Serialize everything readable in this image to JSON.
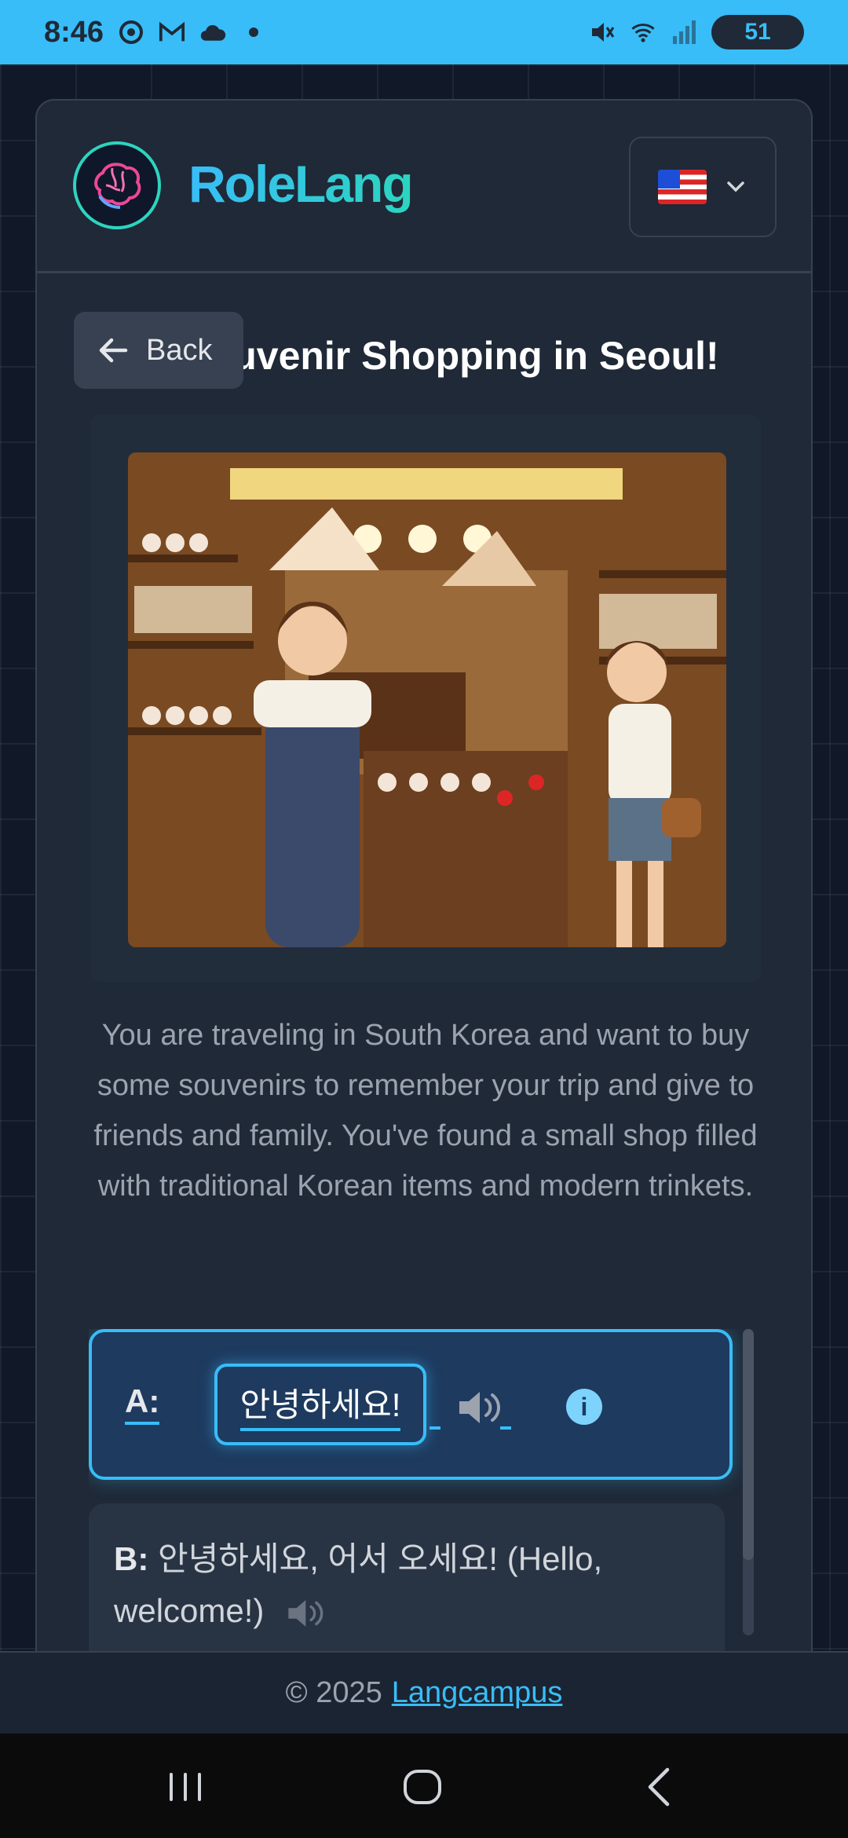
{
  "status_bar": {
    "time": "8:46",
    "battery": "51",
    "left_icons": [
      "chrome-icon",
      "gmail-icon",
      "cloud-icon",
      "dot-icon"
    ],
    "right_icons": [
      "mute-icon",
      "wifi-icon",
      "signal-icon",
      "battery-icon"
    ]
  },
  "header": {
    "app_title": "RoleLang",
    "language_flag": "us-flag-icon"
  },
  "back_label": "Back",
  "scenario": {
    "title": "Souvenir Shopping in Seoul!",
    "description": "You are traveling in South Korea and want to buy some souvenirs to remember your trip and give to friends and family. You've found a small shop filled with traditional Korean items and modern trinkets."
  },
  "dialogue": [
    {
      "speaker": "A:",
      "text": "안녕하세요!"
    },
    {
      "speaker": "B:",
      "text": "안녕하세요, 어서 오세요! (Hello, welcome!)"
    }
  ],
  "footer": {
    "copyright": "© 2025",
    "link": "Langcampus"
  },
  "colors": {
    "accent": "#38bdf8",
    "background": "#111827",
    "card": "#1f2937"
  }
}
